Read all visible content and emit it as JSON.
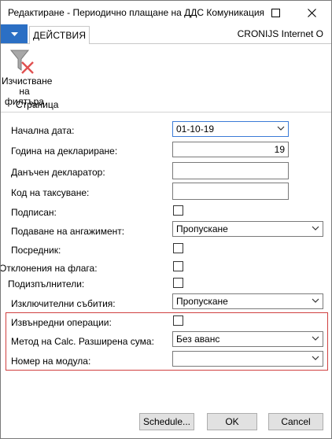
{
  "window": {
    "title": "Редактиране - Периодично плащане на ДДС Комуникация"
  },
  "ribbon": {
    "tab_actions": "ДЕЙСТВИЯ",
    "company": "CRONIJS Internet O",
    "clear_filter_line1": "Изчистване",
    "clear_filter_line2": "на филтъра",
    "group_page": "Страница"
  },
  "form": {
    "start_date_label": "Начална дата:",
    "start_date_value": "01-10-19",
    "decl_year_label": "Година на деклариране:",
    "decl_year_value": "19",
    "tax_declarant_label": "Данъчен декларатор:",
    "tax_declarant_value": "",
    "tax_code_label": "Код на таксуване:",
    "tax_code_value": "",
    "signed_label": "Подписан:",
    "filing_label": "Подаване на ангажимент:",
    "filing_value": "Пропускане",
    "intermediary_label": "Посредник:",
    "flag_deviation_label": "Отклонения на флага:",
    "subcontractors_label": "Подизпълнители:",
    "exceptional_events_label": "Изключителни събития:",
    "exceptional_events_value": "Пропускане",
    "extraordinary_ops_label": "Извънредни операции:",
    "calc_method_label": "Метод на Calc. Разширена сума:",
    "calc_method_value": "Без аванс",
    "module_number_label": "Номер на модула:",
    "module_number_value": ""
  },
  "buttons": {
    "schedule": "Schedule...",
    "ok": "OK",
    "cancel": "Cancel"
  }
}
